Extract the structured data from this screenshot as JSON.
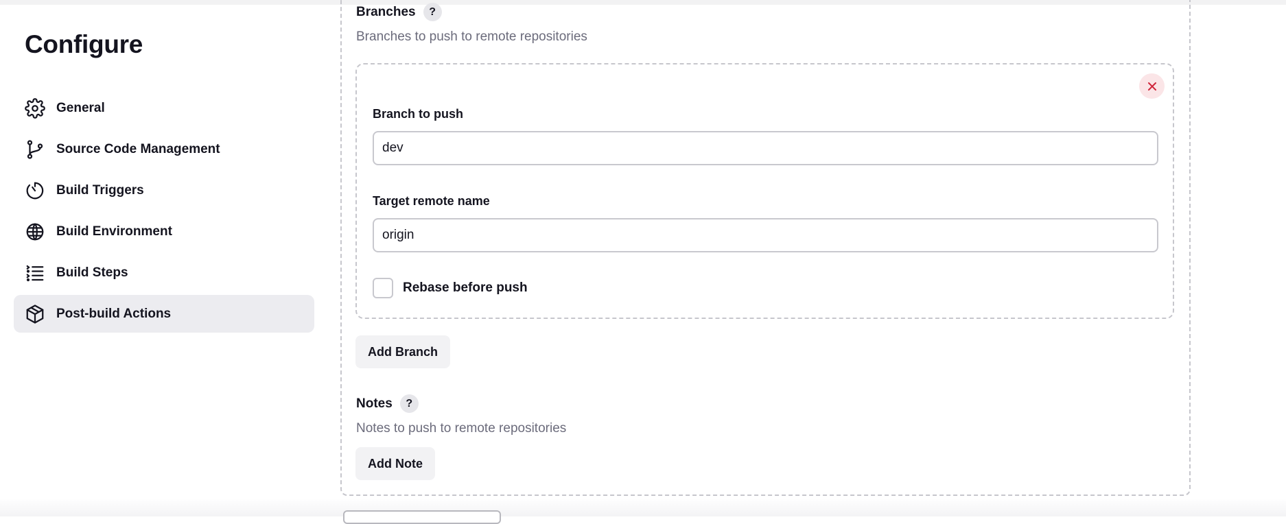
{
  "page": {
    "title": "Configure"
  },
  "sidebar": {
    "items": [
      {
        "label": "General",
        "icon": "gear-icon",
        "active": false
      },
      {
        "label": "Source Code Management",
        "icon": "git-branch-icon",
        "active": false
      },
      {
        "label": "Build Triggers",
        "icon": "timer-icon",
        "active": false
      },
      {
        "label": "Build Environment",
        "icon": "globe-icon",
        "active": false
      },
      {
        "label": "Build Steps",
        "icon": "list-icon",
        "active": false
      },
      {
        "label": "Post-build Actions",
        "icon": "package-icon",
        "active": true
      }
    ]
  },
  "branches": {
    "heading": "Branches",
    "help": "?",
    "description": "Branches to push to remote repositories",
    "item": {
      "branch_label": "Branch to push",
      "branch_value": "dev",
      "remote_label": "Target remote name",
      "remote_value": "origin",
      "rebase_label": "Rebase before push",
      "rebase_checked": false
    },
    "add_button": "Add Branch"
  },
  "notes": {
    "heading": "Notes",
    "help": "?",
    "description": "Notes to push to remote repositories",
    "add_button": "Add Note"
  },
  "colors": {
    "active_nav_bg": "#ececf0",
    "delete_accent": "#d0263b",
    "delete_bg": "#fbe5e7",
    "muted_text": "#6b6b7b"
  }
}
